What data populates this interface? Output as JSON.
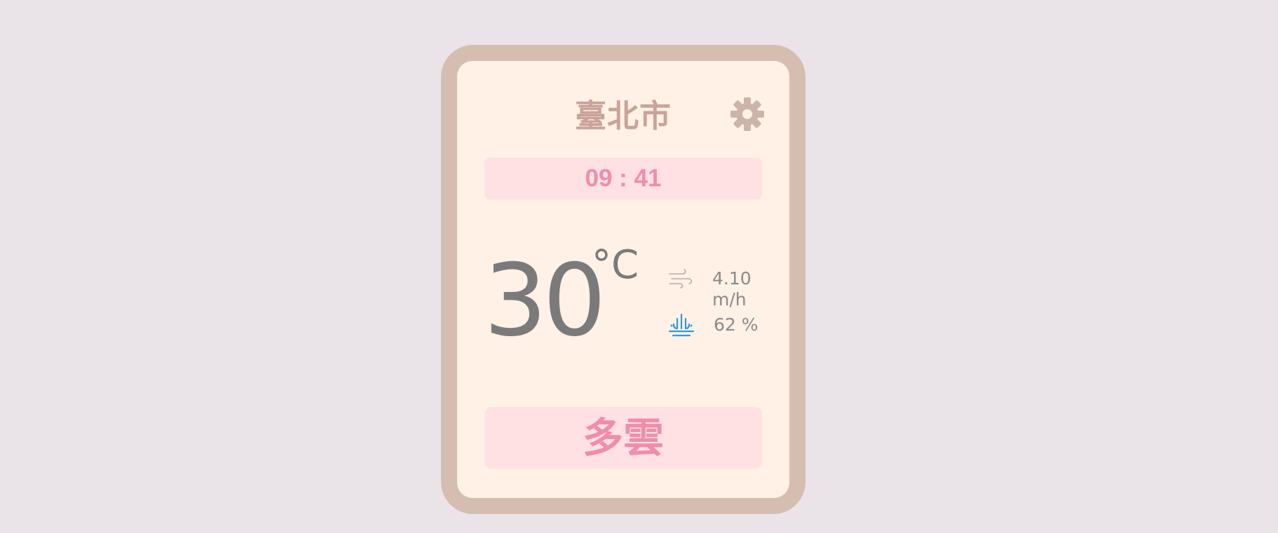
{
  "city": "臺北市",
  "time": "09 : 41",
  "temperature": {
    "value": "30",
    "unit": "°C"
  },
  "wind": {
    "icon": "wind-icon",
    "text": "4.10 m/h"
  },
  "humidity": {
    "icon": "humidity-icon",
    "text": "62 %"
  },
  "condition": "多雲",
  "settings": {
    "icon": "gear-icon"
  },
  "colors": {
    "background": "#EAE4E9",
    "frame": "#D5BEB0",
    "card": "#FFF1E6",
    "accent_pink": "#F08DAC",
    "pink_box": "#FFE1E3",
    "city_text": "#C9A39A",
    "temp_text": "#7A7A7A",
    "humidity_icon": "#2D9CDB"
  }
}
